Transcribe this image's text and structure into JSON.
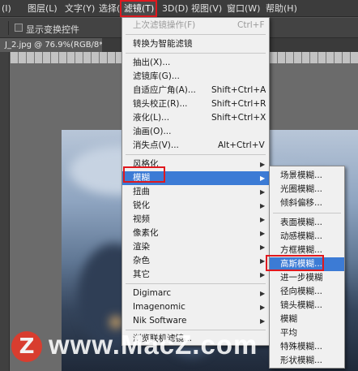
{
  "menubar": {
    "items": [
      {
        "label": "(I)"
      },
      {
        "label": "图层(L)"
      },
      {
        "label": "文字(Y)"
      },
      {
        "label": "选择(S)"
      },
      {
        "label": "滤镜(T)"
      },
      {
        "label": "3D(D)"
      },
      {
        "label": "视图(V)"
      },
      {
        "label": "窗口(W)"
      },
      {
        "label": "帮助(H)"
      }
    ]
  },
  "options_bar": {
    "show_transform_controls": "显示变换控件"
  },
  "document_tab": {
    "title": "J_2.jpg @ 76.9%(RGB/8*) *",
    "close": "×"
  },
  "filter_menu": {
    "items": [
      {
        "label": "上次滤镜操作(F)",
        "shortcut": "Ctrl+F",
        "disabled": true
      },
      {
        "label": "转换为智能滤镜"
      },
      {
        "label": "抽出(X)..."
      },
      {
        "label": "滤镜库(G)..."
      },
      {
        "label": "自适应广角(A)...",
        "shortcut": "Shift+Ctrl+A"
      },
      {
        "label": "镜头校正(R)...",
        "shortcut": "Shift+Ctrl+R"
      },
      {
        "label": "液化(L)...",
        "shortcut": "Shift+Ctrl+X"
      },
      {
        "label": "油画(O)..."
      },
      {
        "label": "消失点(V)...",
        "shortcut": "Alt+Ctrl+V"
      },
      {
        "label": "风格化",
        "submenu": true
      },
      {
        "label": "模糊",
        "submenu": true,
        "highlighted": true
      },
      {
        "label": "扭曲",
        "submenu": true
      },
      {
        "label": "锐化",
        "submenu": true
      },
      {
        "label": "视频",
        "submenu": true
      },
      {
        "label": "像素化",
        "submenu": true
      },
      {
        "label": "渲染",
        "submenu": true
      },
      {
        "label": "杂色",
        "submenu": true
      },
      {
        "label": "其它",
        "submenu": true
      },
      {
        "label": "Digimarc",
        "submenu": true
      },
      {
        "label": "Imagenomic",
        "submenu": true
      },
      {
        "label": "Nik Software",
        "submenu": true
      },
      {
        "label": "浏览联机滤镜..."
      }
    ]
  },
  "blur_submenu": {
    "items": [
      {
        "label": "场景模糊..."
      },
      {
        "label": "光圈模糊..."
      },
      {
        "label": "倾斜偏移..."
      },
      {
        "label": "表面模糊..."
      },
      {
        "label": "动感模糊..."
      },
      {
        "label": "方框模糊..."
      },
      {
        "label": "高斯模糊...",
        "highlighted": true
      },
      {
        "label": "进一步模糊"
      },
      {
        "label": "径向模糊..."
      },
      {
        "label": "镜头模糊..."
      },
      {
        "label": "模糊"
      },
      {
        "label": "平均"
      },
      {
        "label": "特殊模糊..."
      },
      {
        "label": "形状模糊..."
      }
    ]
  },
  "watermark": {
    "logo": "Z",
    "text": "www.MacZ.com"
  },
  "colors": {
    "highlight": "#3c7bd5",
    "annotation_red": "#e0181e",
    "menu_bg": "#f0f0f0",
    "app_bg": "#535353"
  }
}
